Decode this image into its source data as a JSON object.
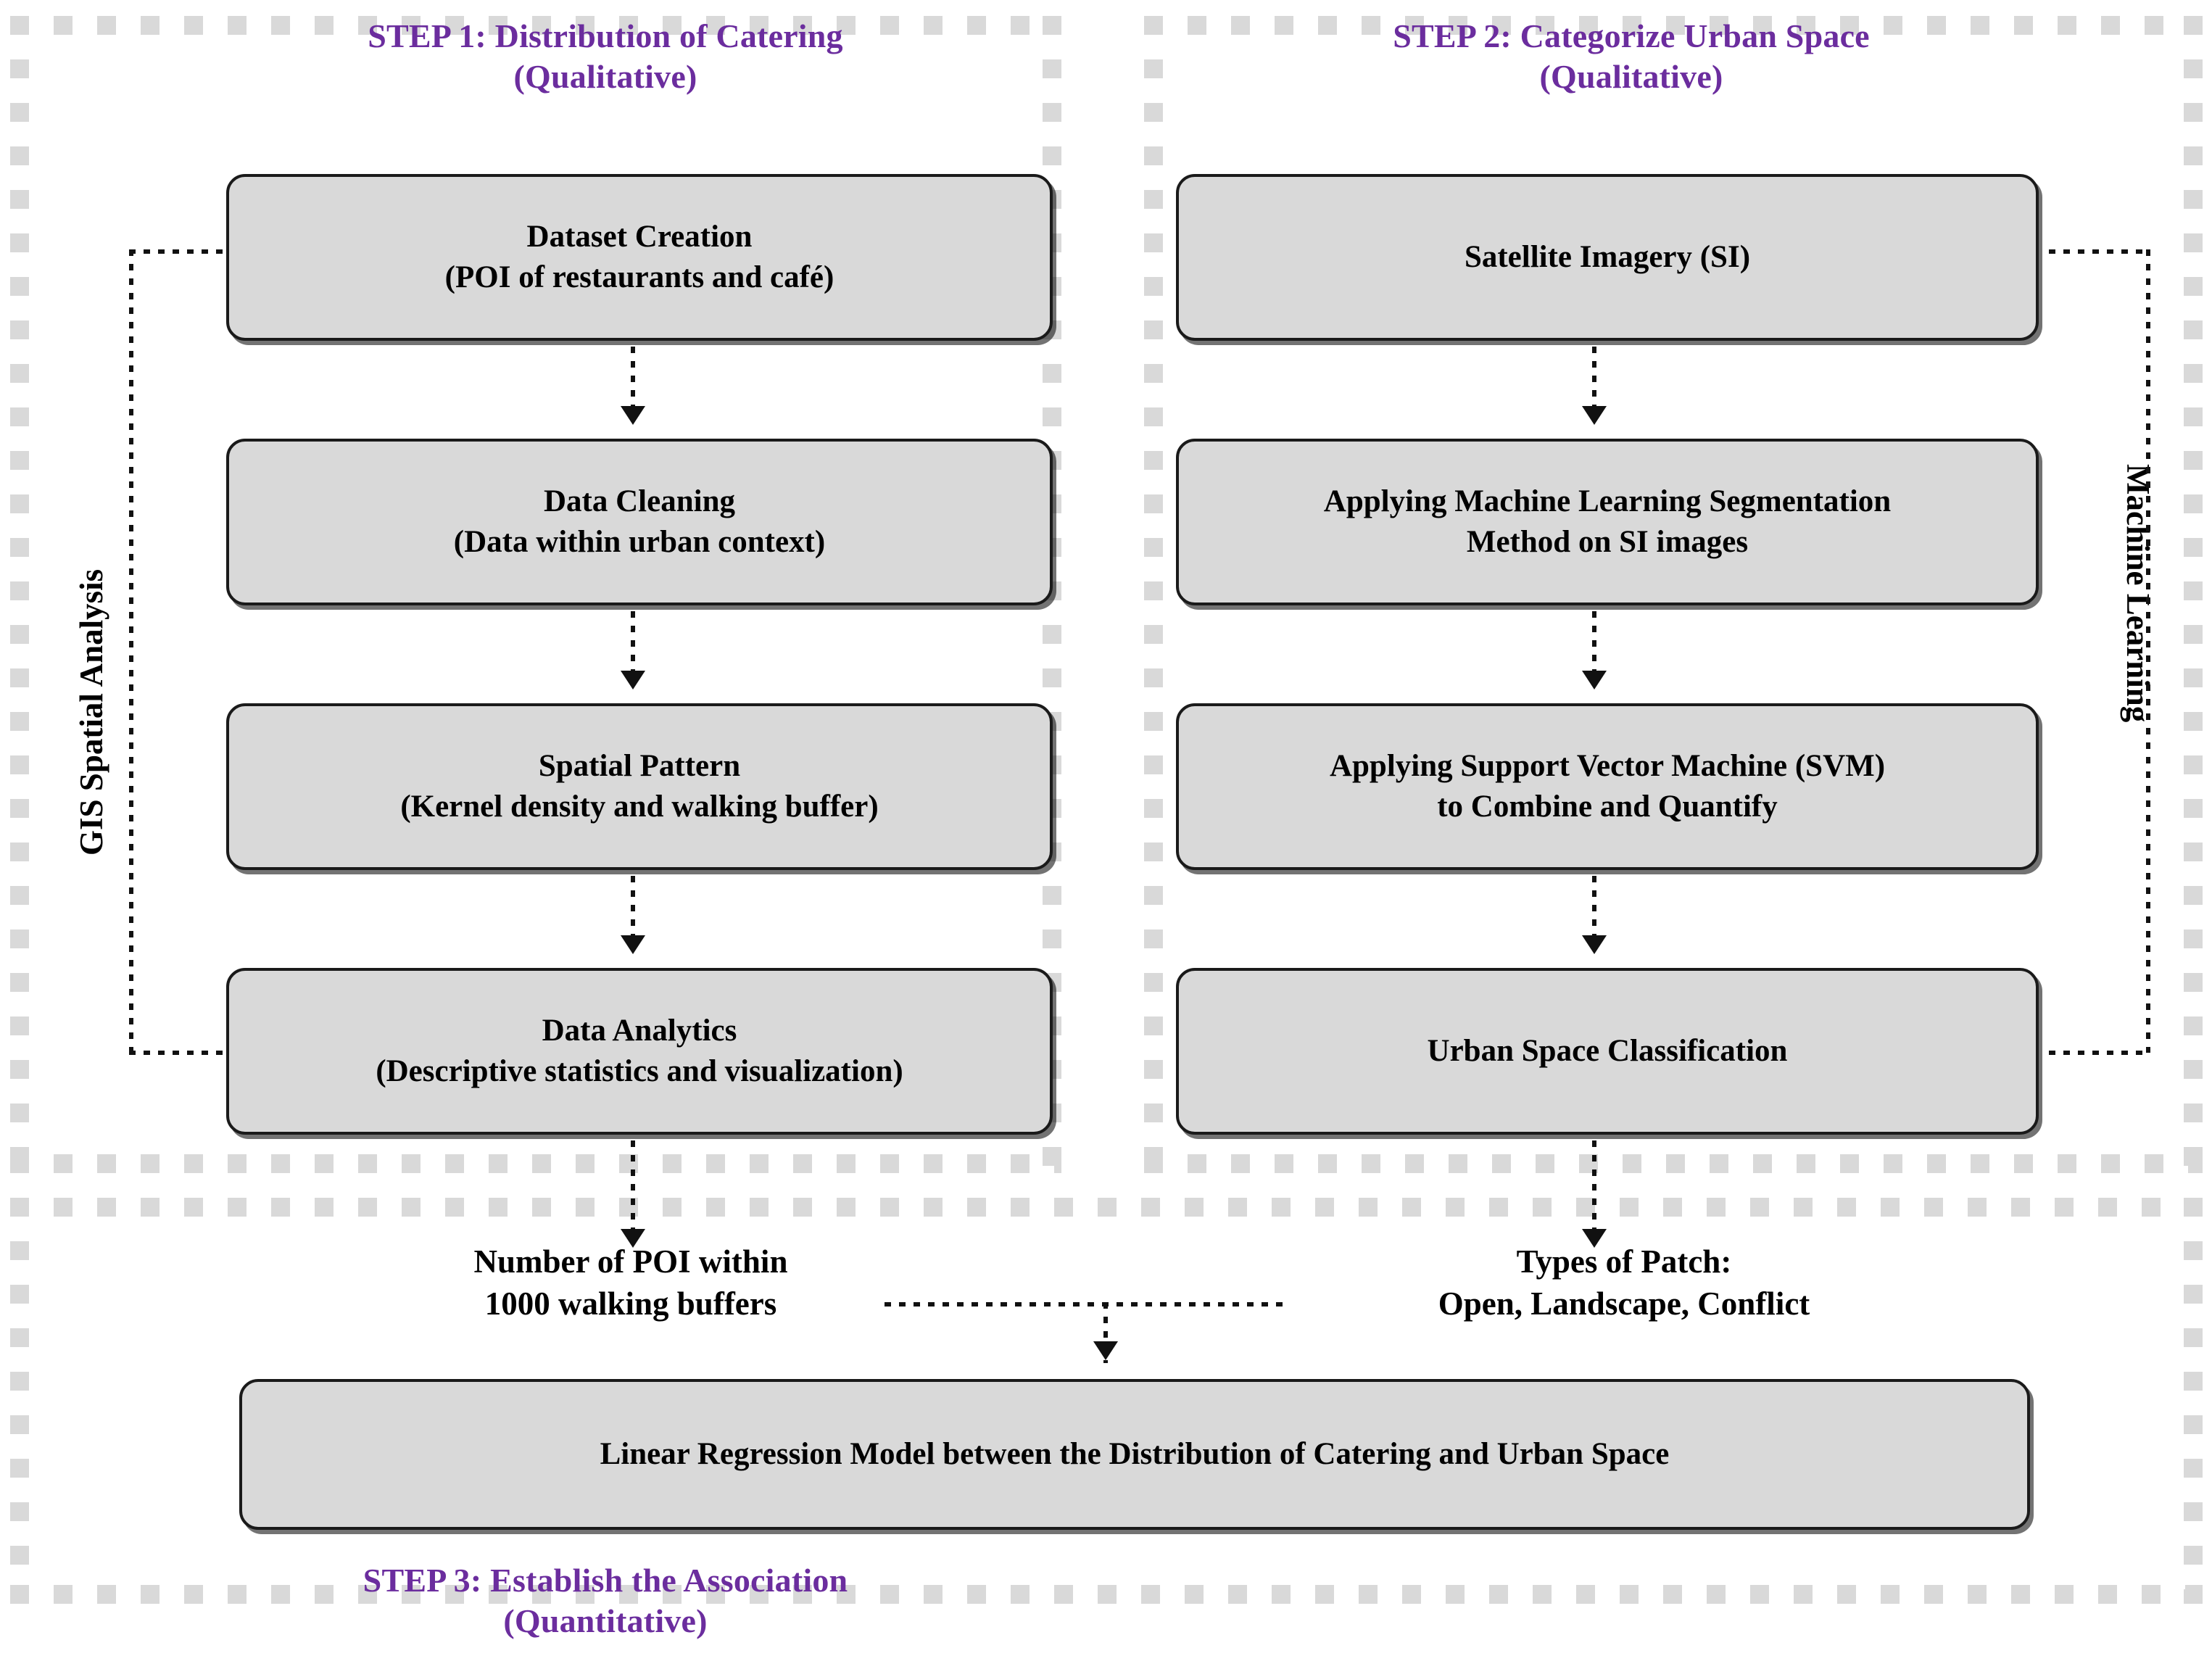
{
  "colors": {
    "step_title_purple": "#6B2D9E",
    "box_fill": "#D9D9D9",
    "box_border": "#1A1A1A",
    "panel_dash": "#D9D9D9",
    "connector": "#111111"
  },
  "steps": [
    {
      "id": "step1",
      "title_line1": "STEP 1: Distribution of Catering",
      "title_line2": "(Qualitative)",
      "side_label": "GIS Spatial Analysis",
      "nodes": [
        {
          "line1": "Dataset Creation",
          "line2": "(POI of restaurants and café)"
        },
        {
          "line1": "Data Cleaning",
          "line2": "(Data within urban context)"
        },
        {
          "line1": "Spatial Pattern",
          "line2": "(Kernel density and walking buffer)"
        },
        {
          "line1": "Data Analytics",
          "line2": "(Descriptive statistics and visualization)"
        }
      ]
    },
    {
      "id": "step2",
      "title_line1": "STEP 2: Categorize Urban Space",
      "title_line2": "(Qualitative)",
      "side_label": "Machine Learning",
      "nodes": [
        {
          "line1": "Satellite Imagery (SI)",
          "line2": ""
        },
        {
          "line1": "Applying Machine Learning Segmentation",
          "line2": "Method on SI images"
        },
        {
          "line1": "Applying Support Vector Machine (SVM)",
          "line2": "to Combine and Quantify"
        },
        {
          "line1": "Urban Space Classification",
          "line2": ""
        }
      ]
    },
    {
      "id": "step3",
      "title_line1": "STEP 3: Establish the Association",
      "title_line2": "(Quantitative)",
      "outputs": [
        {
          "line1": "Number of POI within",
          "line2": "1000 walking buffers"
        },
        {
          "line1": "Types of Patch:",
          "line2": "Open, Landscape, Conflict"
        }
      ],
      "result_node": "Linear Regression Model between the Distribution of Catering and Urban Space"
    }
  ]
}
